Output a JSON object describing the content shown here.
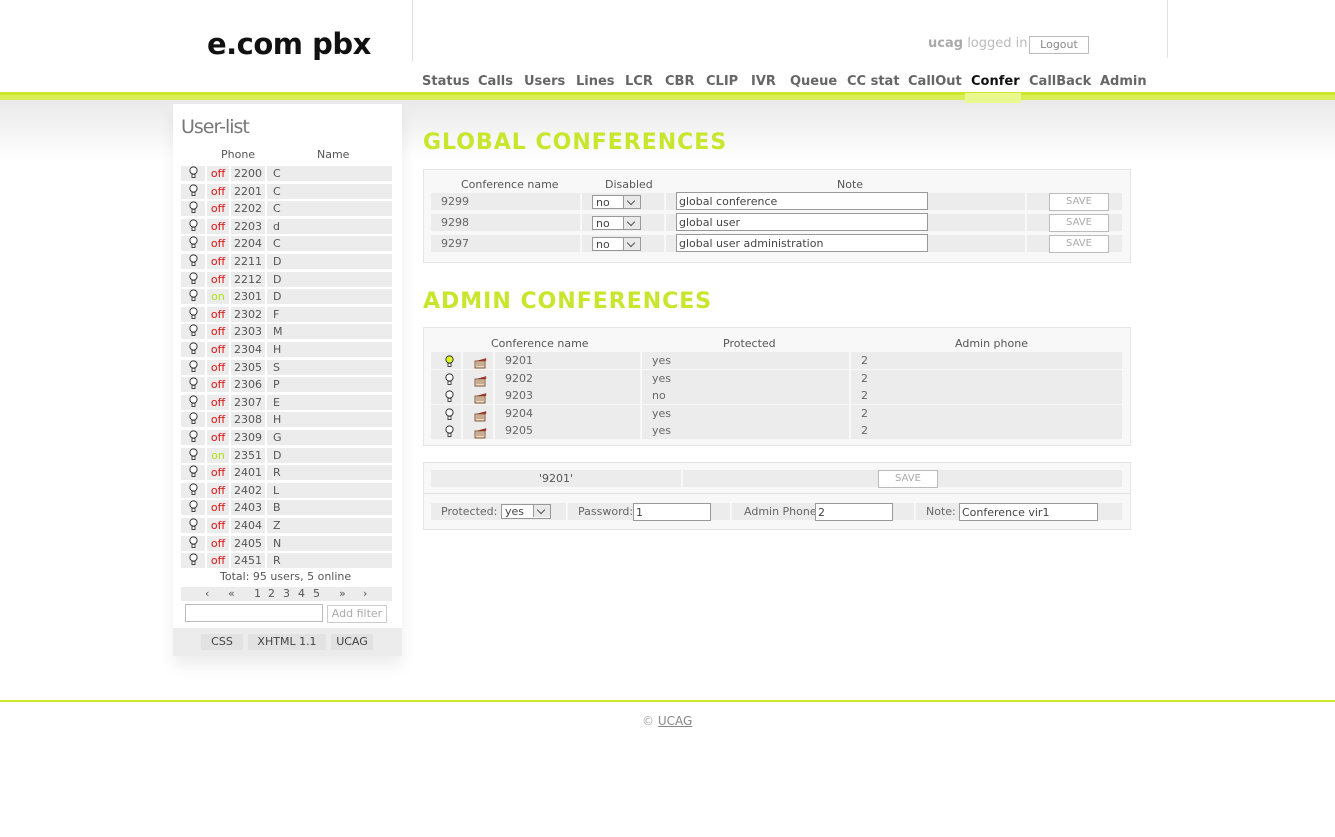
{
  "header": {
    "logo": "e.com pbx",
    "user": "ucag",
    "logged_in_text": "logged in",
    "logout_label": "Logout"
  },
  "nav": {
    "items": [
      "Status",
      "Calls",
      "Users",
      "Lines",
      "LCR",
      "CBR",
      "CLIP",
      "IVR",
      "Queue",
      "CC stat",
      "CallOut",
      "Confer",
      "CallBack",
      "Admin"
    ],
    "active": "Confer"
  },
  "sidebar": {
    "title": "User-list",
    "col_phone": "Phone",
    "col_name": "Name",
    "rows": [
      {
        "status": "off",
        "phone": "2200",
        "name": "C"
      },
      {
        "status": "off",
        "phone": "2201",
        "name": "C"
      },
      {
        "status": "off",
        "phone": "2202",
        "name": "C"
      },
      {
        "status": "off",
        "phone": "2203",
        "name": "d"
      },
      {
        "status": "off",
        "phone": "2204",
        "name": "C"
      },
      {
        "status": "off",
        "phone": "2211",
        "name": "D"
      },
      {
        "status": "off",
        "phone": "2212",
        "name": "D"
      },
      {
        "status": "on",
        "phone": "2301",
        "name": "D"
      },
      {
        "status": "off",
        "phone": "2302",
        "name": "F"
      },
      {
        "status": "off",
        "phone": "2303",
        "name": "M"
      },
      {
        "status": "off",
        "phone": "2304",
        "name": "H"
      },
      {
        "status": "off",
        "phone": "2305",
        "name": "S"
      },
      {
        "status": "off",
        "phone": "2306",
        "name": "P"
      },
      {
        "status": "off",
        "phone": "2307",
        "name": "E"
      },
      {
        "status": "off",
        "phone": "2308",
        "name": "H"
      },
      {
        "status": "off",
        "phone": "2309",
        "name": "G"
      },
      {
        "status": "on",
        "phone": "2351",
        "name": "D"
      },
      {
        "status": "off",
        "phone": "2401",
        "name": "R"
      },
      {
        "status": "off",
        "phone": "2402",
        "name": "L"
      },
      {
        "status": "off",
        "phone": "2403",
        "name": "B"
      },
      {
        "status": "off",
        "phone": "2404",
        "name": "Z"
      },
      {
        "status": "off",
        "phone": "2405",
        "name": "N"
      },
      {
        "status": "off",
        "phone": "2451",
        "name": "R"
      }
    ],
    "total": "Total: 95 users, 5 online",
    "pager": [
      "‹",
      "«",
      "1",
      "2",
      "3",
      "4",
      "5",
      "»",
      "›"
    ],
    "filter_value": "",
    "filter_button": "Add filter",
    "footer_links": [
      "CSS",
      "XHTML 1.1",
      "UCAG"
    ]
  },
  "global": {
    "title": "GLOBAL CONFERENCES",
    "col_name": "Conference name",
    "col_disabled": "Disabled",
    "col_note": "Note",
    "save_label": "SAVE",
    "rows": [
      {
        "name": "9299",
        "disabled": "no",
        "note": "global conference"
      },
      {
        "name": "9298",
        "disabled": "no",
        "note": "global user"
      },
      {
        "name": "9297",
        "disabled": "no",
        "note": "global user administration"
      }
    ]
  },
  "admin": {
    "title": "ADMIN CONFERENCES",
    "col_name": "Conference name",
    "col_protected": "Protected",
    "col_phone": "Admin phone",
    "rows": [
      {
        "name": "9201",
        "protected": "yes",
        "phone": "2",
        "active": true
      },
      {
        "name": "9202",
        "protected": "yes",
        "phone": "2",
        "active": false
      },
      {
        "name": "9203",
        "protected": "no",
        "phone": "2",
        "active": false
      },
      {
        "name": "9204",
        "protected": "yes",
        "phone": "2",
        "active": false
      },
      {
        "name": "9205",
        "protected": "yes",
        "phone": "2",
        "active": false
      }
    ]
  },
  "edit": {
    "selected": "'9201'",
    "save_label": "SAVE",
    "protected_label": "Protected:",
    "protected_value": "yes",
    "password_label": "Password:",
    "password_value": "1",
    "phone_label": "Admin Phone:",
    "phone_value": "2",
    "note_label": "Note:",
    "note_value": "Conference vir1"
  },
  "footer": {
    "copy": "©",
    "link": "UCAG"
  },
  "colors": {
    "accent": "#cce62e",
    "title_green": "#c8e62b",
    "status_off": "#dd1111",
    "status_on": "#aee21a"
  }
}
